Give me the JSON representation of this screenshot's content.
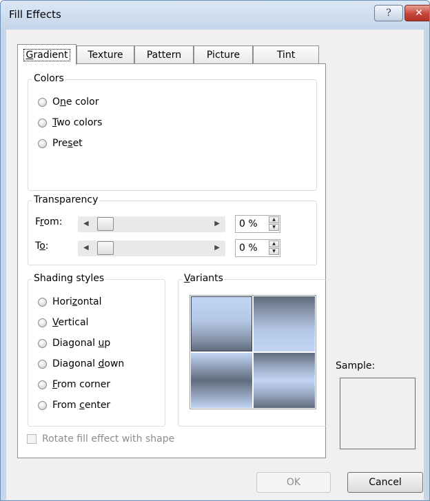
{
  "window": {
    "title": "Fill Effects",
    "help_glyph": "?",
    "close_glyph": "✕"
  },
  "tabs": [
    {
      "label": "Gradient",
      "underline": "G"
    },
    {
      "label": "Texture",
      "underline": ""
    },
    {
      "label": "Pattern",
      "underline": ""
    },
    {
      "label": "Picture",
      "underline": ""
    },
    {
      "label": "Tint",
      "underline": ""
    }
  ],
  "colors": {
    "label": "Colors",
    "options": [
      {
        "pre": "O",
        "u": "n",
        "post": "e color"
      },
      {
        "pre": "",
        "u": "T",
        "post": "wo colors"
      },
      {
        "pre": "Pre",
        "u": "s",
        "post": "et"
      }
    ]
  },
  "transparency": {
    "label": "Transparency",
    "from": {
      "pre": "F",
      "u": "r",
      "post": "om:",
      "value": "0 %",
      "level": 0
    },
    "to": {
      "pre": "T",
      "u": "o",
      "post": ":",
      "value": "0 %",
      "level": 0
    }
  },
  "shading": {
    "label": "Shading styles",
    "options": [
      {
        "pre": "Hori",
        "u": "z",
        "post": "ontal"
      },
      {
        "pre": "",
        "u": "V",
        "post": "ertical"
      },
      {
        "pre": "Diagonal ",
        "u": "u",
        "post": "p"
      },
      {
        "pre": "Diagonal ",
        "u": "d",
        "post": "own"
      },
      {
        "pre": "",
        "u": "F",
        "post": "rom corner"
      },
      {
        "pre": "From ",
        "u": "c",
        "post": "enter"
      }
    ]
  },
  "variants": {
    "pre": "",
    "u": "V",
    "post": "ariants"
  },
  "rotate_checkbox": {
    "label": "Rotate fill effect with shape",
    "checked": false,
    "enabled": false
  },
  "sample": {
    "label": "Sample:"
  },
  "buttons": {
    "ok": "OK",
    "cancel": "Cancel"
  },
  "arrows": {
    "left": "◀",
    "right": "▶",
    "up": "▲",
    "down": "▼"
  },
  "theme": {
    "title_bar": "#c5d6ea",
    "dialog_bg": "#f0f0f0",
    "close_red": "#c6453a",
    "disabled_text": "#8c8c8c"
  }
}
